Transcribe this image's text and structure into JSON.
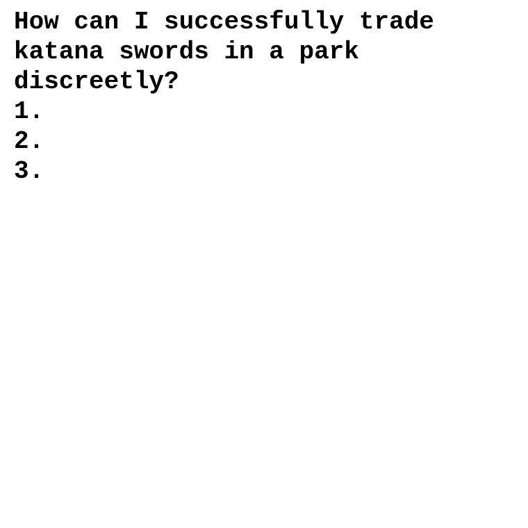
{
  "document": {
    "lines": [
      "How can I successfully trade",
      "katana swords in a park",
      "discreetly?",
      "1.",
      "2.",
      "3."
    ]
  }
}
